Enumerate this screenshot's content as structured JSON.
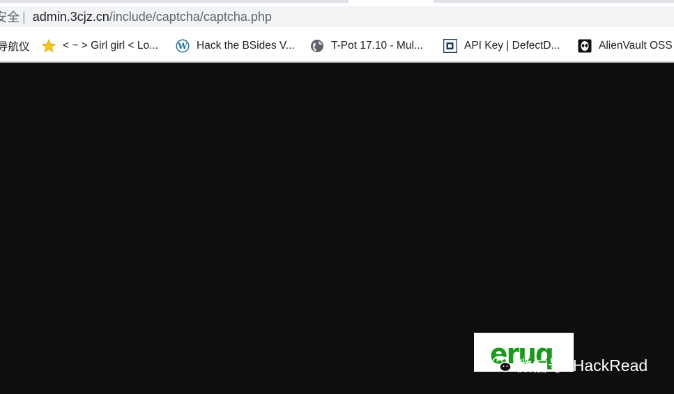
{
  "browser": {
    "omnibox": {
      "security_label": "安全",
      "divider": "|",
      "url_host": "admin.3cjz.cn",
      "url_path": "/include/captcha/captcha.php"
    },
    "bookmarks": [
      {
        "label": "导航仪",
        "icon": "folder-icon"
      },
      {
        "label": "< ~ > Girl girl < Lo...",
        "icon": "star-icon"
      },
      {
        "label": "Hack the BSides V...",
        "icon": "wordpress-icon"
      },
      {
        "label": "T-Pot 17.10 - Mul...",
        "icon": "globe-icon"
      },
      {
        "label": "API Key | DefectD...",
        "icon": "defectdojo-icon"
      },
      {
        "label": "AlienVault OSS",
        "icon": "alienvault-icon"
      }
    ]
  },
  "page": {
    "background": "#0e0e0e",
    "captcha_image": {
      "text": "eruq",
      "color": "#1a9a1a"
    }
  },
  "watermark": {
    "text": "微信号: HackRead",
    "icon": "wechat-icon"
  }
}
